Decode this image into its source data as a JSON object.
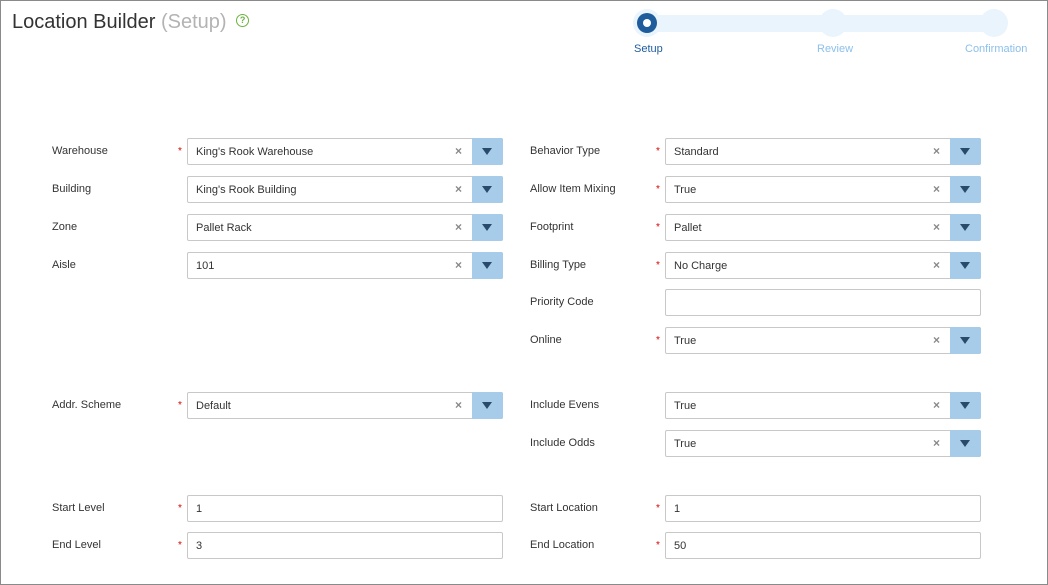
{
  "header": {
    "title": "Location Builder",
    "subtitle": "(Setup)",
    "help_icon": "?"
  },
  "wizard": {
    "steps": [
      "Setup",
      "Review",
      "Confirmation"
    ],
    "active": "Setup"
  },
  "form": {
    "warehouse": {
      "label": "Warehouse",
      "value": "King's Rook Warehouse"
    },
    "building": {
      "label": "Building",
      "value": "King's Rook Building"
    },
    "zone": {
      "label": "Zone",
      "value": "Pallet Rack"
    },
    "aisle": {
      "label": "Aisle",
      "value": "101"
    },
    "addr_scheme": {
      "label": "Addr. Scheme",
      "value": "Default"
    },
    "start_level": {
      "label": "Start Level",
      "value": "1"
    },
    "end_level": {
      "label": "End Level",
      "value": "3"
    },
    "behavior_type": {
      "label": "Behavior Type",
      "value": "Standard"
    },
    "allow_item_mixing": {
      "label": "Allow Item Mixing",
      "value": "True"
    },
    "footprint": {
      "label": "Footprint",
      "value": "Pallet"
    },
    "billing_type": {
      "label": "Billing Type",
      "value": "No Charge"
    },
    "priority_code": {
      "label": "Priority Code",
      "value": ""
    },
    "online": {
      "label": "Online",
      "value": "True"
    },
    "include_evens": {
      "label": "Include Evens",
      "value": "True"
    },
    "include_odds": {
      "label": "Include Odds",
      "value": "True"
    },
    "start_location": {
      "label": "Start Location",
      "value": "1"
    },
    "end_location": {
      "label": "End Location",
      "value": "50"
    }
  },
  "icons": {
    "required": "*",
    "clear": "×"
  },
  "colors": {
    "accent": "#1e5c9b",
    "dropdown": "#a7cce9",
    "required": "#dd0000",
    "help": "#6cb33f"
  }
}
